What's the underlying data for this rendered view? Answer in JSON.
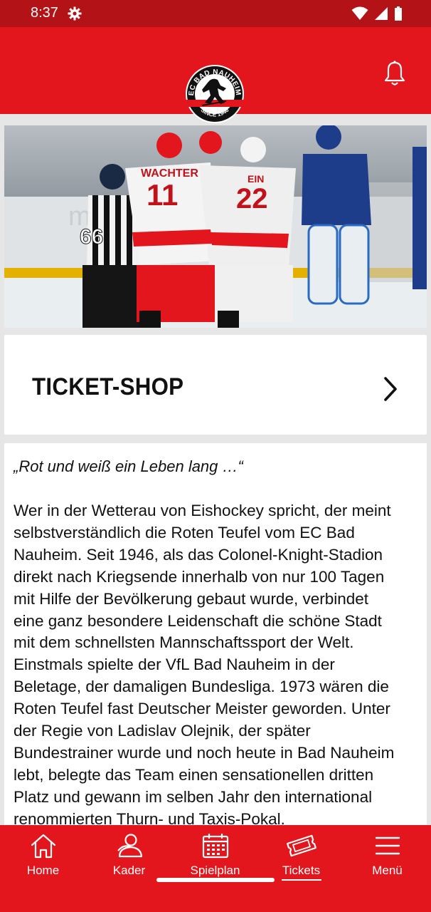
{
  "status_bar": {
    "time": "8:37"
  },
  "header": {
    "logo": {
      "top_text": "EC BAD NAUHEIM",
      "bottom_text": "SINCE 1946"
    },
    "bell_icon": "bell-icon"
  },
  "hero": {
    "player_names": [
      "WACHTER",
      "EIN"
    ],
    "player_numbers": [
      "11",
      "22",
      "66"
    ]
  },
  "ticket_shop": {
    "title": "TICKET-SHOP"
  },
  "content": {
    "quote": "„Rot und weiß ein Leben lang …“",
    "lines": [
      "Wer in der Wetterau von Eishockey spricht, der meint",
      "selbstverständlich die Roten Teufel vom EC Bad",
      "Nauheim. Seit 1946, als das Colonel-Knight-Stadion",
      "direkt nach Kriegsende innerhalb von nur 100 Tagen",
      "mit Hilfe der Bevölkerung gebaut wurde, verbindet",
      "eine ganz besondere Leidenschaft die schöne Stadt",
      "mit dem schnellsten Mannschaftssport der Welt.",
      "Einstmals spielte der VfL Bad Nauheim in der",
      "Beletage, der damaligen Bundesliga. 1973 wären die",
      "Roten Teufel fast Deutscher Meister geworden. Unter",
      "der Regie von Ladislav Olejnik, der später",
      "Bundestrainer wurde und noch heute in Bad Nauheim",
      "lebt, belegte das Team einen sensationellen dritten",
      "Platz und gewann im selben Jahr den international",
      "renommierten Thurn- und Taxis-Pokal."
    ]
  },
  "bottom_nav": {
    "items": [
      {
        "label": "Home",
        "icon": "home-icon"
      },
      {
        "label": "Kader",
        "icon": "kader-icon"
      },
      {
        "label": "Spielplan",
        "icon": "calendar-icon"
      },
      {
        "label": "Tickets",
        "icon": "ticket-icon",
        "active": true
      },
      {
        "label": "Menü",
        "icon": "menu-icon"
      }
    ]
  },
  "colors": {
    "brand_red": "#e3161d",
    "status_bar": "#b31217",
    "text": "#111111"
  }
}
